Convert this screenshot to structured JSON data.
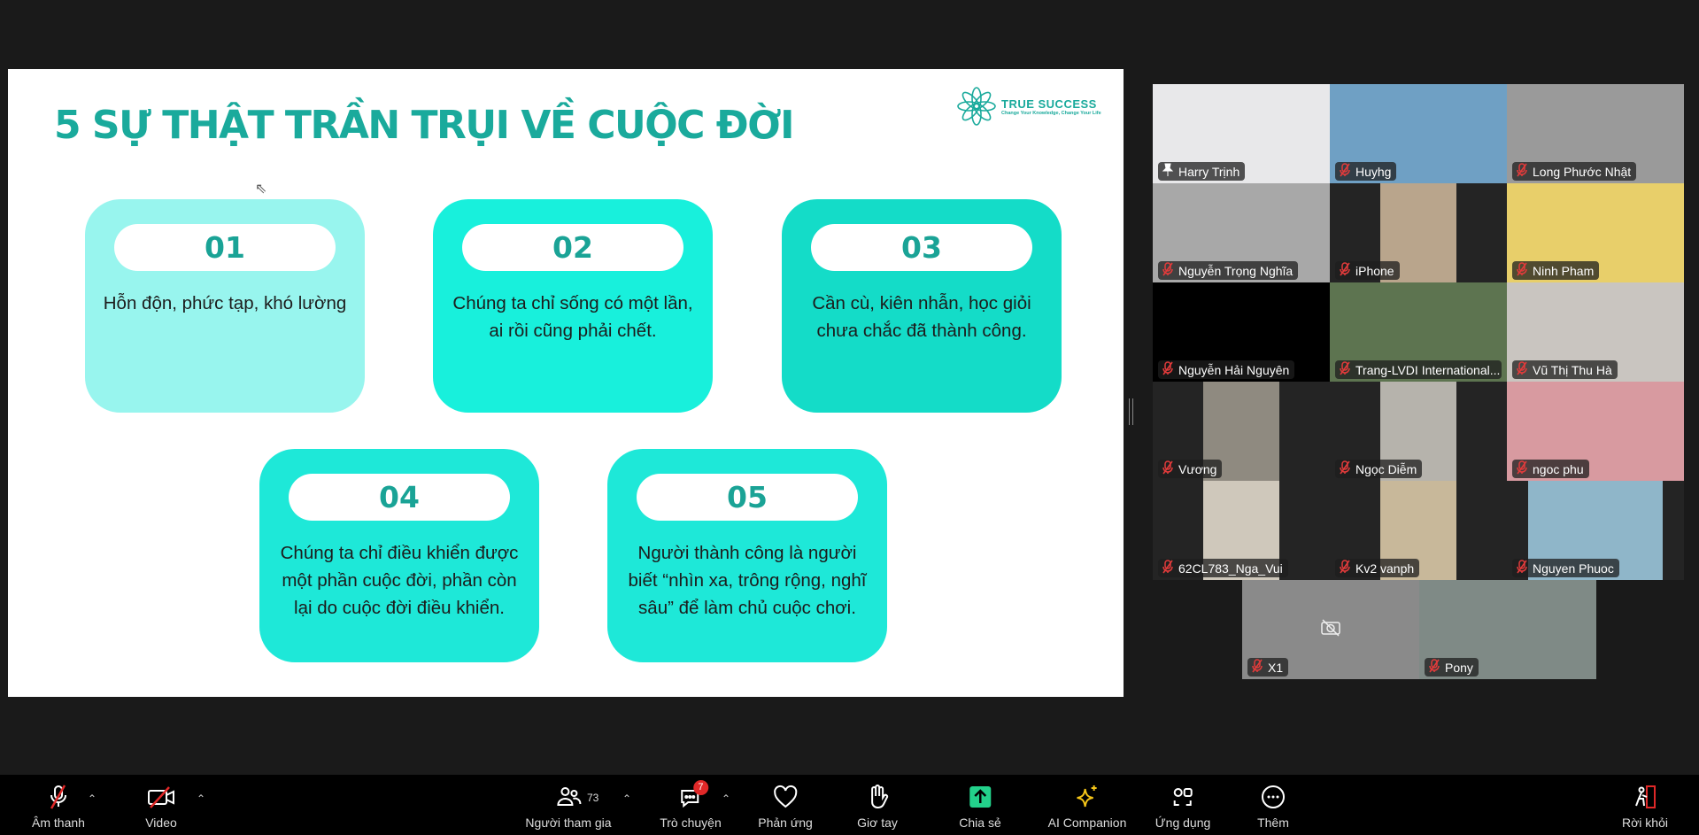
{
  "slide": {
    "title": "5 SỰ THẬT TRẦN TRỤI VỀ CUỘC ĐỜI",
    "logo": {
      "brand": "TRUE SUCCESS",
      "tagline": "Change Your Knowledge, Change Your Life"
    },
    "cards": [
      {
        "number": "01",
        "text": "Hỗn độn, phức tạp, khó lường",
        "color": "#98f5ee"
      },
      {
        "number": "02",
        "text": "Chúng ta chỉ sống có một lần, ai rồi cũng phải chết.",
        "color": "#18f0dc"
      },
      {
        "number": "03",
        "text": "Cần cù, kiên nhẫn, học giỏi chưa chắc đã thành công.",
        "color": "#14dcc8"
      },
      {
        "number": "04",
        "text": "Chúng ta chỉ điều khiển được một phần cuộc đời, phần còn lại do cuộc đời điều khiển.",
        "color": "#1ee8d8"
      },
      {
        "number": "05",
        "text": "Người thành công là người biết “nhìn xa, trông rộng, nghĩ sâu” để làm chủ cuộc chơi.",
        "color": "#1ee8d8"
      }
    ]
  },
  "gallery": {
    "participants": [
      {
        "name": "Harry Trịnh",
        "active": true,
        "bg": "#e8e8ea",
        "muted": false
      },
      {
        "name": "Huyhg",
        "bg": "#6fa0c4",
        "muted": true
      },
      {
        "name": "Long Phước Nhật",
        "bg": "#9a9a9a",
        "muted": true
      },
      {
        "name": "Nguyễn Trọng Nghĩa",
        "bg": "#a8a8a8",
        "muted": true
      },
      {
        "name": "iPhone",
        "bg": "#b9a58c",
        "muted": true
      },
      {
        "name": "Ninh Pham",
        "bg": "#e8cf6a",
        "muted": true
      },
      {
        "name": "Nguyễn Hải Nguyên",
        "bg": "#000000",
        "muted": true
      },
      {
        "name": "Trang-LVDI International...",
        "bg": "#5d7450",
        "muted": true
      },
      {
        "name": "Vũ Thị Thu Hà",
        "bg": "#c9c5c0",
        "muted": true
      },
      {
        "name": "Vương",
        "bg": "#8f8a80",
        "muted": true
      },
      {
        "name": "Ngọc Diễm",
        "bg": "#b6b3ac",
        "muted": true
      },
      {
        "name": "ngoc phu",
        "bg": "#d89aa0",
        "muted": true
      },
      {
        "name": "62CL783_Nga_Vui",
        "bg": "#cfc8bb",
        "muted": true
      },
      {
        "name": "Kv2 vanph",
        "bg": "#c8b89a",
        "muted": true
      },
      {
        "name": "Nguyen Phuoc",
        "bg": "#8fb6c9",
        "muted": true
      },
      {
        "name": "X1",
        "bg": "#8a8a8a",
        "muted": true,
        "camera_off": true
      },
      {
        "name": "Pony",
        "bg": "#7f8a86",
        "muted": true
      }
    ]
  },
  "toolbar": {
    "audio": "Âm thanh",
    "video": "Video",
    "participants": "Người tham gia",
    "participants_count": "73",
    "chat": "Trò chuyện",
    "chat_badge": "7",
    "reactions": "Phản ứng",
    "raise_hand": "Giơ tay",
    "share": "Chia sẻ",
    "share_color": "#23d18b",
    "ai_companion": "AI Companion",
    "ai_color": "#f5c518",
    "apps": "Ứng dụng",
    "more": "Thêm",
    "leave": "Rời khỏi",
    "leave_color": "#e02828"
  }
}
